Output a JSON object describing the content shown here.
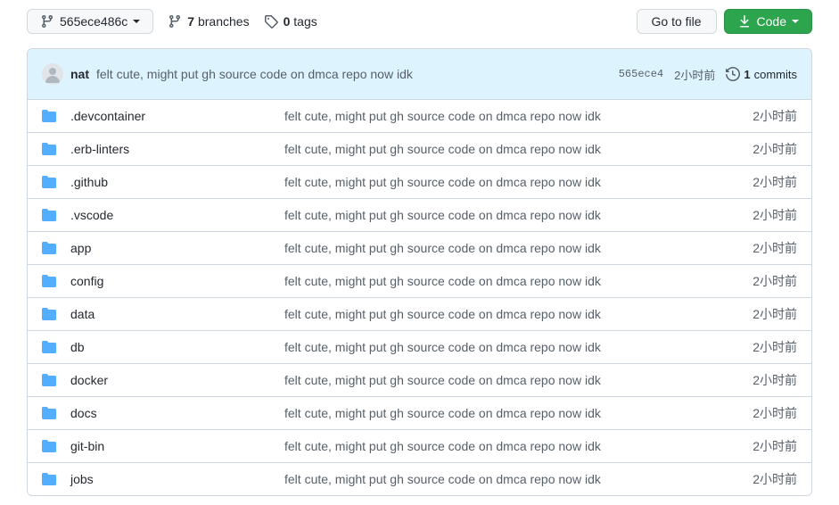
{
  "toolbar": {
    "branch_name": "565ece486c",
    "branches_count": "7",
    "branches_label": "branches",
    "tags_count": "0",
    "tags_label": "tags",
    "go_to_file": "Go to file",
    "code_label": "Code"
  },
  "latest_commit": {
    "author": "nat",
    "message": "felt cute, might put gh source code on dmca repo now idk",
    "sha": "565ece4",
    "time": "2小时前",
    "commits_count": "1",
    "commits_label": "commits"
  },
  "files": [
    {
      "name": ".devcontainer",
      "message": "felt cute, might put gh source code on dmca repo now idk",
      "age": "2小时前"
    },
    {
      "name": ".erb-linters",
      "message": "felt cute, might put gh source code on dmca repo now idk",
      "age": "2小时前"
    },
    {
      "name": ".github",
      "message": "felt cute, might put gh source code on dmca repo now idk",
      "age": "2小时前"
    },
    {
      "name": ".vscode",
      "message": "felt cute, might put gh source code on dmca repo now idk",
      "age": "2小时前"
    },
    {
      "name": "app",
      "message": "felt cute, might put gh source code on dmca repo now idk",
      "age": "2小时前"
    },
    {
      "name": "config",
      "message": "felt cute, might put gh source code on dmca repo now idk",
      "age": "2小时前"
    },
    {
      "name": "data",
      "message": "felt cute, might put gh source code on dmca repo now idk",
      "age": "2小时前"
    },
    {
      "name": "db",
      "message": "felt cute, might put gh source code on dmca repo now idk",
      "age": "2小时前"
    },
    {
      "name": "docker",
      "message": "felt cute, might put gh source code on dmca repo now idk",
      "age": "2小时前"
    },
    {
      "name": "docs",
      "message": "felt cute, might put gh source code on dmca repo now idk",
      "age": "2小时前"
    },
    {
      "name": "git-bin",
      "message": "felt cute, might put gh source code on dmca repo now idk",
      "age": "2小时前"
    },
    {
      "name": "jobs",
      "message": "felt cute, might put gh source code on dmca repo now idk",
      "age": "2小时前"
    }
  ]
}
